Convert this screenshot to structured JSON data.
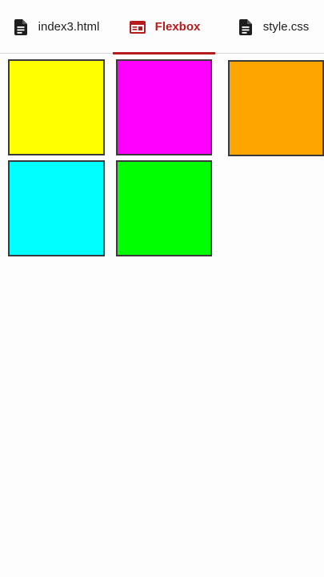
{
  "tabs": [
    {
      "label": "index3.html",
      "icon": "document-icon",
      "active": false
    },
    {
      "label": "Flexbox",
      "icon": "browser-window-icon",
      "active": true
    },
    {
      "label": "style.css",
      "icon": "document-icon",
      "active": false
    }
  ],
  "accent_color": "#b71c1c",
  "boxes": [
    {
      "color": "#ffff00"
    },
    {
      "color": "#ff00ff"
    },
    {
      "color": "#ffa500"
    },
    {
      "color": "#00ffff"
    },
    {
      "color": "#00ff00"
    }
  ]
}
